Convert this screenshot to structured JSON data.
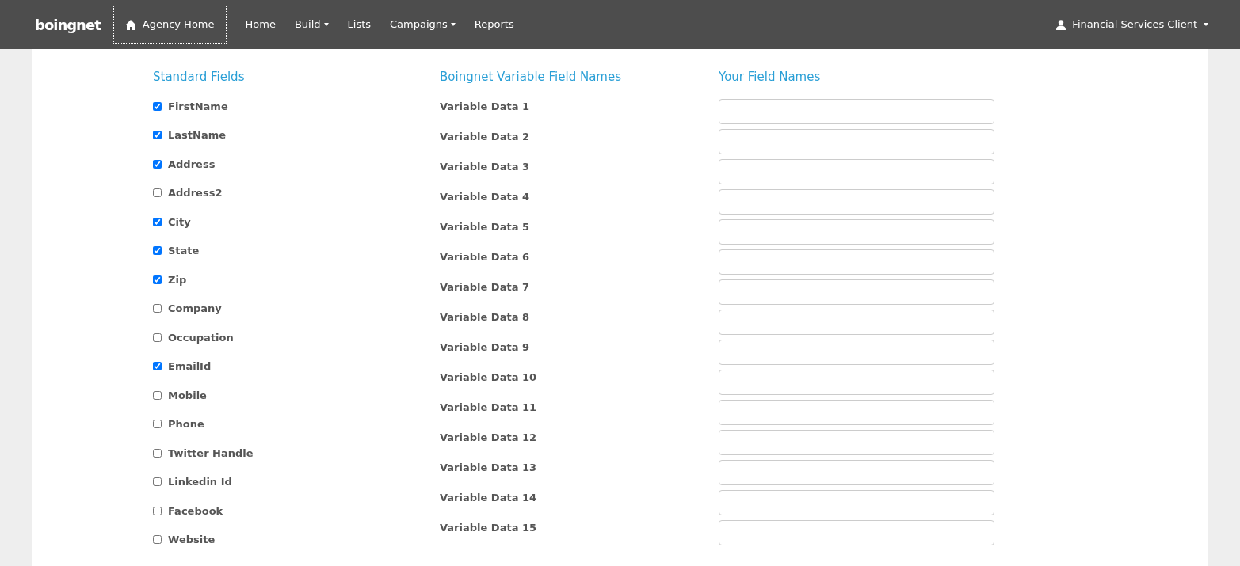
{
  "navbar": {
    "logo": "boingnet",
    "home_button": "Agency Home",
    "links": [
      {
        "label": "Home",
        "dropdown": false
      },
      {
        "label": "Build",
        "dropdown": true
      },
      {
        "label": "Lists",
        "dropdown": false
      },
      {
        "label": "Campaigns",
        "dropdown": true
      },
      {
        "label": "Reports",
        "dropdown": false
      }
    ],
    "user_menu": "Financial Services Client"
  },
  "standard_fields": {
    "title": "Standard Fields",
    "items": [
      {
        "label": "FirstName",
        "checked": true
      },
      {
        "label": "LastName",
        "checked": true
      },
      {
        "label": "Address",
        "checked": true
      },
      {
        "label": "Address2",
        "checked": false
      },
      {
        "label": "City",
        "checked": true
      },
      {
        "label": "State",
        "checked": true
      },
      {
        "label": "Zip",
        "checked": true
      },
      {
        "label": "Company",
        "checked": false
      },
      {
        "label": "Occupation",
        "checked": false
      },
      {
        "label": "EmailId",
        "checked": true
      },
      {
        "label": "Mobile",
        "checked": false
      },
      {
        "label": "Phone",
        "checked": false
      },
      {
        "label": "Twitter Handle",
        "checked": false
      },
      {
        "label": "Linkedin Id",
        "checked": false
      },
      {
        "label": "Facebook",
        "checked": false
      },
      {
        "label": "Website",
        "checked": false
      }
    ]
  },
  "variable_fields": {
    "title": "Boingnet Variable Field Names",
    "your_title": "Your Field Names",
    "rows": [
      "Variable Data 1",
      "Variable Data 2",
      "Variable Data 3",
      "Variable Data 4",
      "Variable Data 5",
      "Variable Data 6",
      "Variable Data 7",
      "Variable Data 8",
      "Variable Data 9",
      "Variable Data 10",
      "Variable Data 11",
      "Variable Data 12",
      "Variable Data 13",
      "Variable Data 14",
      "Variable Data 15"
    ]
  }
}
